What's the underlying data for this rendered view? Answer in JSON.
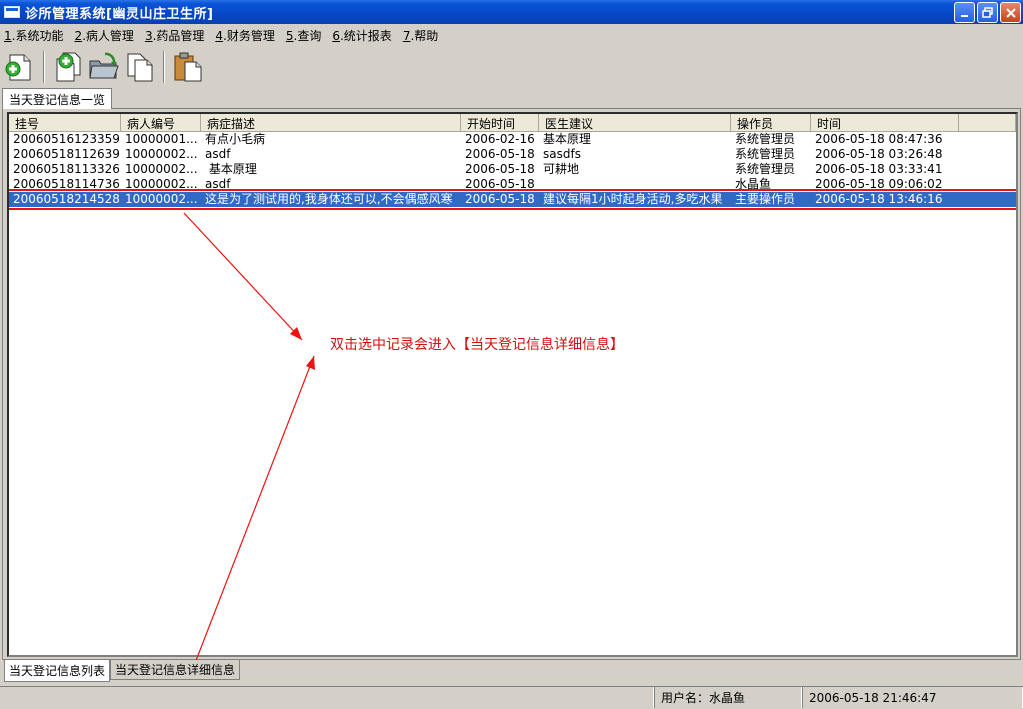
{
  "window": {
    "title": "诊所管理系统[幽灵山庄卫生所]",
    "controls": [
      "minimize-icon",
      "restore-icon",
      "close-icon"
    ]
  },
  "menu": [
    {
      "num": "1",
      "label": ".系统功能"
    },
    {
      "num": "2",
      "label": ".病人管理"
    },
    {
      "num": "3",
      "label": ".药品管理"
    },
    {
      "num": "4",
      "label": ".财务管理"
    },
    {
      "num": "5",
      "label": ".查询"
    },
    {
      "num": "6",
      "label": ".统计报表"
    },
    {
      "num": "7",
      "label": ".帮助"
    }
  ],
  "toolbar": {
    "buttons": [
      "new-doc-plus-icon",
      "copy-plus-icon",
      "folder-save-icon",
      "copy-icon",
      "paste-icon"
    ]
  },
  "top_tab": {
    "label": "当天登记信息一览"
  },
  "table": {
    "columns": [
      "挂号",
      "病人编号",
      "病症描述",
      "开始时间",
      "医生建议",
      "操作员",
      "时间",
      ""
    ],
    "rows": [
      {
        "reg": "20060516123359",
        "pid": "10000001...",
        "desc": "有点小毛病",
        "start": "2006-02-16",
        "advice": "基本原理",
        "op": "系统管理员",
        "time": "2006-05-18 08:47:36"
      },
      {
        "reg": "20060518112639",
        "pid": "10000002...",
        "desc": "asdf",
        "start": "2006-05-18",
        "advice": "sasdfs",
        "op": "系统管理员",
        "time": "2006-05-18 03:26:48"
      },
      {
        "reg": "20060518113326",
        "pid": "10000002...",
        "desc": " 基本原理",
        "start": "2006-05-18",
        "advice": "可耕地",
        "op": "系统管理员",
        "time": "2006-05-18 03:33:41"
      },
      {
        "reg": "20060518114736",
        "pid": "10000002...",
        "desc": "asdf",
        "start": "2006-05-18",
        "advice": "",
        "op": "水晶鱼",
        "time": "2006-05-18 09:06:02"
      },
      {
        "reg": "20060518214528",
        "pid": "10000002...",
        "desc": "这是为了测试用的,我身体还可以,不会偶感风寒",
        "start": "2006-05-18",
        "advice": "建议每隔1小时起身活动,多吃水果",
        "op": "主要操作员",
        "time": "2006-05-18 13:46:16"
      }
    ],
    "selected_index": 4
  },
  "annotation": {
    "text": "双击选中记录会进入【当天登记信息详细信息】",
    "color": "#d41010"
  },
  "bottom_tabs": [
    {
      "label": "当天登记信息列表",
      "active": true
    },
    {
      "label": "当天登记信息详细信息",
      "active": false
    }
  ],
  "status": {
    "user": "用户名：水晶鱼",
    "datetime": "2006-05-18  21:46:47"
  }
}
